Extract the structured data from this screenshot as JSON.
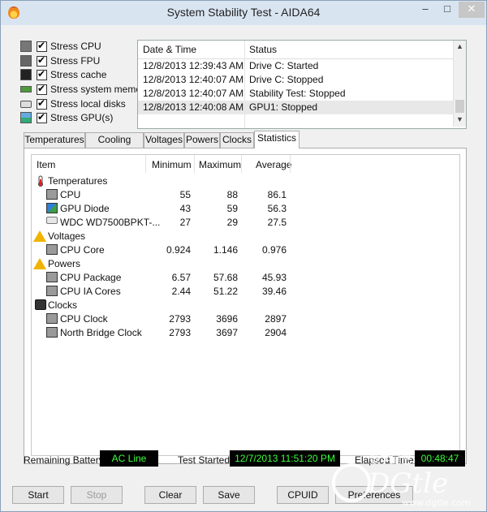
{
  "window": {
    "title": "System Stability Test - AIDA64"
  },
  "stress_options": [
    {
      "label": "Stress CPU",
      "checked": true,
      "icon": "cpu-icon"
    },
    {
      "label": "Stress FPU",
      "checked": true,
      "icon": "fpu-icon"
    },
    {
      "label": "Stress cache",
      "checked": true,
      "icon": "cache-icon"
    },
    {
      "label": "Stress system memory",
      "checked": true,
      "icon": "memory-icon"
    },
    {
      "label": "Stress local disks",
      "checked": true,
      "icon": "disk-icon"
    },
    {
      "label": "Stress GPU(s)",
      "checked": true,
      "icon": "gpu-icon"
    }
  ],
  "log": {
    "headers": {
      "datetime": "Date & Time",
      "status": "Status"
    },
    "rows": [
      {
        "datetime": "12/8/2013 12:39:43 AM",
        "status": "Drive C: Started"
      },
      {
        "datetime": "12/8/2013 12:40:07 AM",
        "status": "Drive C: Stopped"
      },
      {
        "datetime": "12/8/2013 12:40:07 AM",
        "status": "Stability Test: Stopped"
      },
      {
        "datetime": "12/8/2013 12:40:08 AM",
        "status": "GPU1: Stopped"
      }
    ]
  },
  "tabs": [
    "Temperatures",
    "Cooling Fans",
    "Voltages",
    "Powers",
    "Clocks",
    "Statistics"
  ],
  "active_tab": "Statistics",
  "stats": {
    "headers": {
      "item": "Item",
      "minimum": "Minimum",
      "maximum": "Maximum",
      "average": "Average"
    },
    "rows": [
      {
        "kind": "group",
        "label": "Temperatures",
        "icon": "thermometer-icon"
      },
      {
        "kind": "item",
        "label": "CPU",
        "min": "55",
        "max": "88",
        "avg": "86.1",
        "icon": "chip-icon"
      },
      {
        "kind": "item",
        "label": "GPU Diode",
        "min": "43",
        "max": "59",
        "avg": "56.3",
        "icon": "gpu-icon"
      },
      {
        "kind": "item",
        "label": "WDC WD7500BPKT-...",
        "min": "27",
        "max": "29",
        "avg": "27.5",
        "icon": "disk-icon"
      },
      {
        "kind": "group",
        "label": "Voltages",
        "icon": "warning-icon"
      },
      {
        "kind": "item",
        "label": "CPU Core",
        "min": "0.924",
        "max": "1.146",
        "avg": "0.976",
        "icon": "chip-icon"
      },
      {
        "kind": "group",
        "label": "Powers",
        "icon": "warning-icon"
      },
      {
        "kind": "item",
        "label": "CPU Package",
        "min": "6.57",
        "max": "57.68",
        "avg": "45.93",
        "icon": "chip-icon"
      },
      {
        "kind": "item",
        "label": "CPU IA Cores",
        "min": "2.44",
        "max": "51.22",
        "avg": "39.46",
        "icon": "chip-icon"
      },
      {
        "kind": "group",
        "label": "Clocks",
        "icon": "clock-icon"
      },
      {
        "kind": "item",
        "label": "CPU Clock",
        "min": "2793",
        "max": "3696",
        "avg": "2897",
        "icon": "chip-icon"
      },
      {
        "kind": "item",
        "label": "North Bridge Clock",
        "min": "2793",
        "max": "3697",
        "avg": "2904",
        "icon": "chip-icon"
      }
    ]
  },
  "status": {
    "battery_label": "Remaining Battery:",
    "battery_value": "AC Line",
    "test_started_label": "Test Started:",
    "test_started_value": "12/7/2013 11:51:20 PM",
    "elapsed_label": "Elapsed Time:",
    "elapsed_value": "00:48:47"
  },
  "buttons": {
    "start": "Start",
    "stop": "Stop",
    "clear": "Clear",
    "save": "Save",
    "cpuid": "CPUID",
    "preferences": "Preferences"
  },
  "watermark": {
    "cn": "数字尾巴",
    "brand": "DGtle",
    "url": "www.dgtle.com"
  },
  "colors": {
    "lcd_bg": "#000000",
    "lcd_text": "#3cff3c",
    "selected_row": "#e8e8e8"
  }
}
